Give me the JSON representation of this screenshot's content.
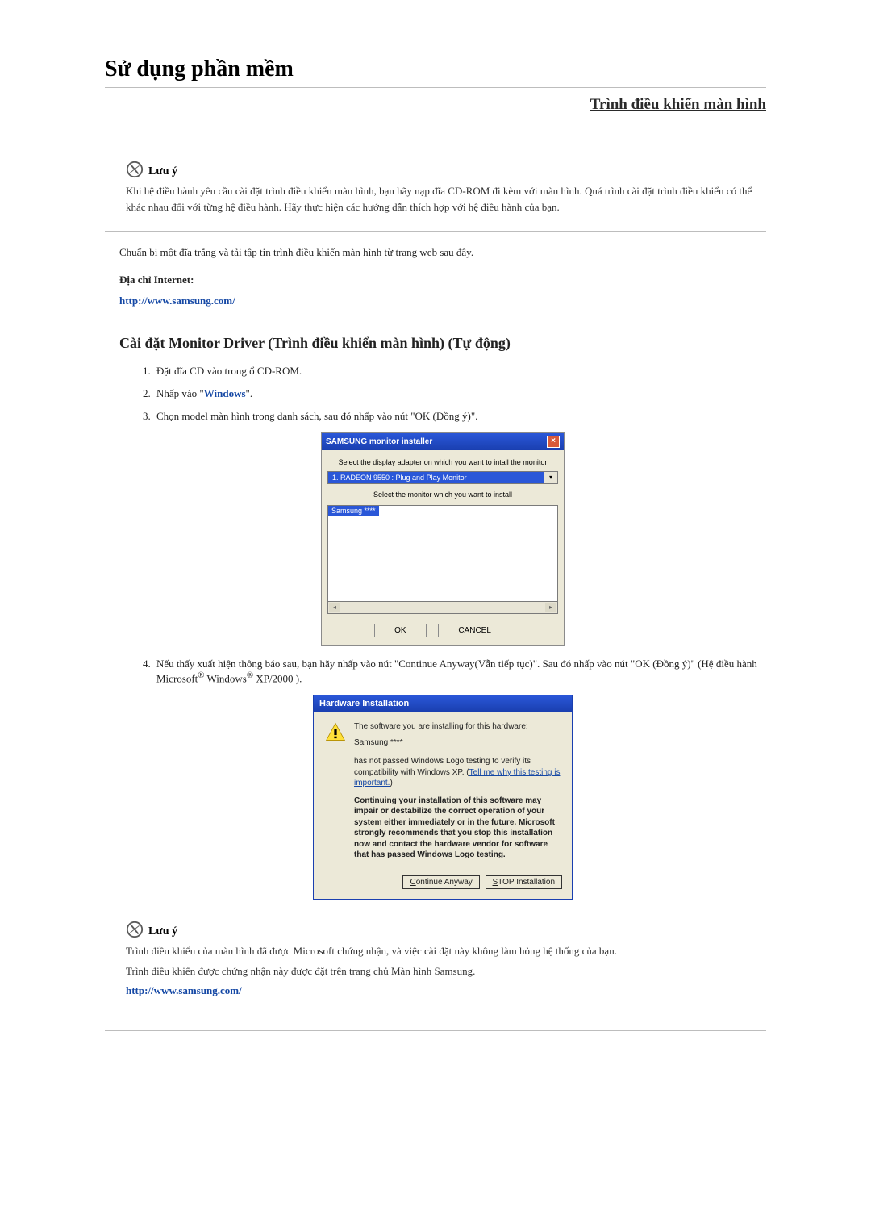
{
  "title": "Sử dụng phần mềm",
  "headerLink": "Trình điều khiển màn hình",
  "note1": {
    "label": "Lưu ý",
    "text": "Khi hệ điều hành yêu cầu cài đặt trình điều khiển màn hình, bạn hãy nạp đĩa CD-ROM đi kèm với màn hình. Quá trình cài đặt trình điều khiển có thể khác nhau đối với từng hệ điều hành. Hãy thực hiện các hướng dẫn thích hợp với hệ điều hành của bạn."
  },
  "prep": "Chuẩn bị một đĩa trắng và tải tập tin trình điều khiển màn hình từ trang web sau đây.",
  "internetLabel": "Địa chỉ Internet:",
  "samsungUrl": "http://www.samsung.com/",
  "subhead": "Cài đặt Monitor Driver (Trình điều khiển màn hình) (Tự động)",
  "steps": {
    "s1": "Đặt đĩa CD vào trong ổ CD-ROM.",
    "s2a": "Nhấp vào \"",
    "s2b": "Windows",
    "s2c": "\".",
    "s3": "Chọn model màn hình trong danh sách, sau đó nhấp vào nút \"OK (Đồng ý)\".",
    "s4a": "Nếu thấy xuất hiện thông báo sau, bạn hãy nhấp vào nút \"Continue Anyway(Vẫn tiếp tục)\". Sau đó nhấp vào nút \"OK (Đồng ý)\" (Hệ điều hành Microsoft",
    "s4b": "®",
    "s4c": " Windows",
    "s4d": "®",
    "s4e": " XP/2000 )."
  },
  "installer": {
    "title": "SAMSUNG monitor installer",
    "caption1": "Select the display adapter on which you want to intall the monitor",
    "adapter": "1. RADEON 9550 : Plug and Play Monitor",
    "caption2": "Select the monitor which you want to install",
    "listItem": "Samsung ****",
    "ok": "OK",
    "cancel": "CANCEL"
  },
  "hw": {
    "title": "Hardware Installation",
    "line1": "The software you are installing for this hardware:",
    "line2": "Samsung ****",
    "line3a": "has not passed Windows Logo testing to verify its compatibility with Windows XP. (",
    "line3link": "Tell me why this testing is important.",
    "line3b": ")",
    "bold": "Continuing your installation of this software may impair or destabilize the correct operation of your system either immediately or in the future. Microsoft strongly recommends that you stop this installation now and contact the hardware vendor for software that has passed Windows Logo testing.",
    "btnContinue": "Continue Anyway",
    "btnStop": "STOP Installation"
  },
  "note2": {
    "label": "Lưu ý",
    "line1": "Trình điều khiển của màn hình đã được Microsoft chứng nhận, và việc cài đặt này không làm hỏng hệ thống của bạn.",
    "line2": "Trình điều khiển được chứng nhận này được đặt trên trang chủ Màn hình Samsung."
  }
}
